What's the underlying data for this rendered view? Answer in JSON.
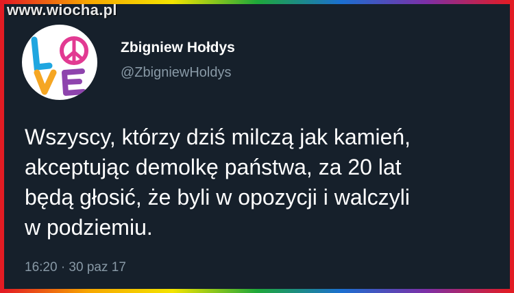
{
  "watermark": "www.wiocha.pl",
  "tweet": {
    "author_name": "Zbigniew Hołdys",
    "author_handle": "@ZbigniewHoldys",
    "avatar_icon": "love-peace-avatar-icon",
    "text": "Wszyscy, którzy dziś milczą jak kamień,\nakceptując demolkę państwa, za 20 lat\nbędą głosić, że byli w opozycji i walczyli\nw podziemiu.",
    "timestamp": "16:20 · 30 paz 17"
  },
  "colors": {
    "background": "#16202b",
    "text": "#ffffff",
    "muted": "#8899a6"
  }
}
